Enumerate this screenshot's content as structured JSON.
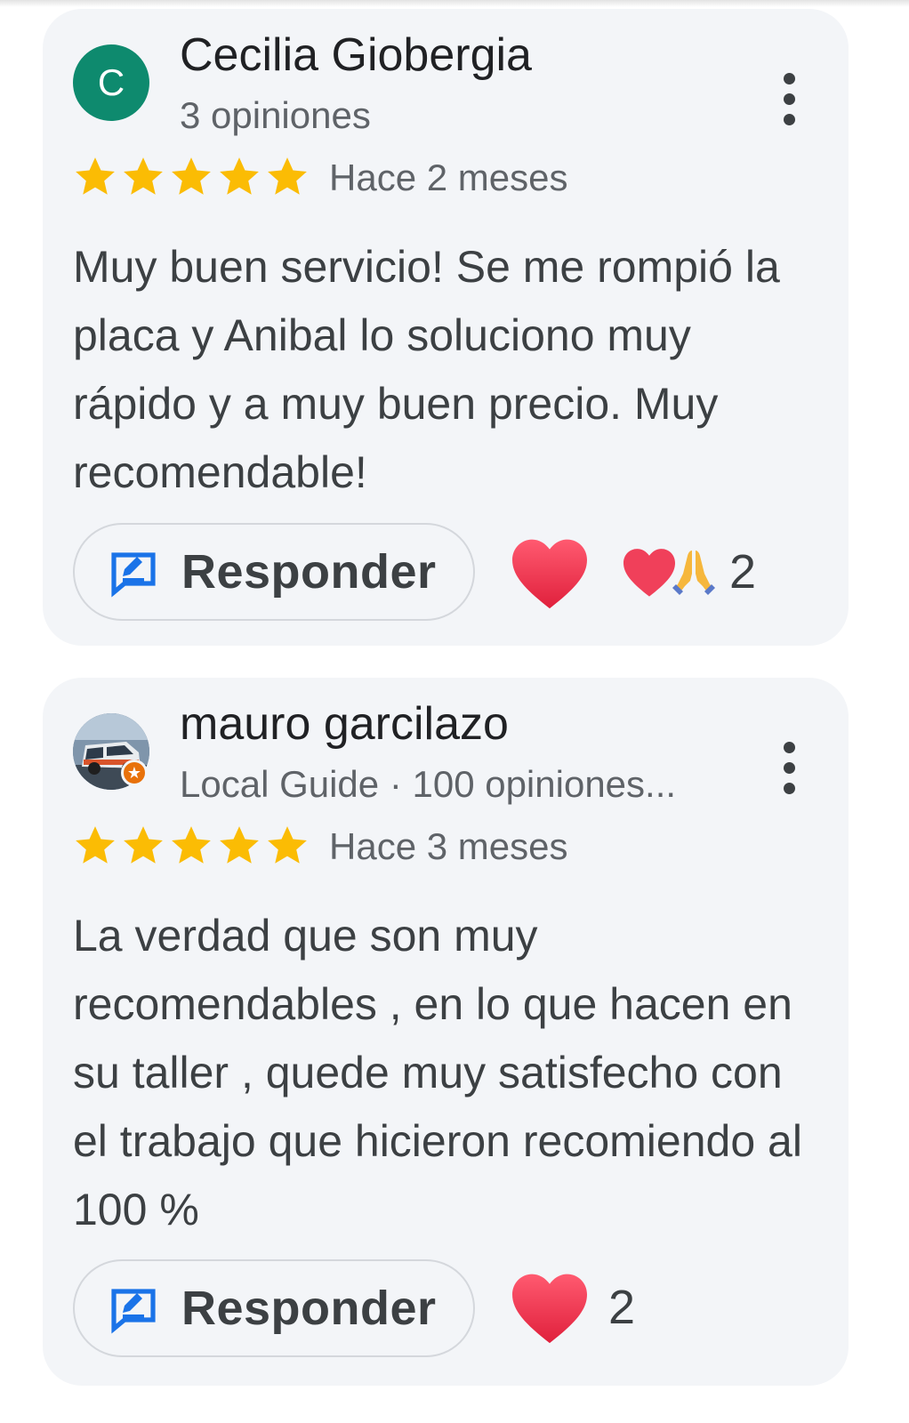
{
  "reviews": [
    {
      "author": "Cecilia Giobergia",
      "avatar_letter": "C",
      "meta": "3 opiniones",
      "rating": 5,
      "date": "Hace 2 meses",
      "text": "Muy buen servicio! Se me rompió la placa y Anibal lo soluciono muy rápido y a muy buen precio. Muy recomendable!",
      "reply_label": "Responder",
      "reactions": {
        "icons": [
          "heart-icon",
          "praying-hands-icon"
        ],
        "count": "2"
      }
    },
    {
      "author": "mauro garcilazo",
      "avatar_icon": "profile-photo-van",
      "meta": "Local Guide · 100 opiniones...",
      "rating": 5,
      "date": "Hace 3 meses",
      "text": "La verdad que son muy recomendables , en lo que hacen en su taller , quede muy satisfecho con el trabajo que hicieron recomiendo al 100 %",
      "reply_label": "Responder",
      "reactions": {
        "icons": [
          "heart-icon"
        ],
        "count": "2"
      }
    }
  ],
  "colors": {
    "card_bg": "#f3f5f8",
    "star": "#fbbc04",
    "avatar_green": "#0e8a6e",
    "reply_icon_blue": "#1a73e8",
    "heart": "#f0405a",
    "local_guide_badge": "#e8710a"
  }
}
